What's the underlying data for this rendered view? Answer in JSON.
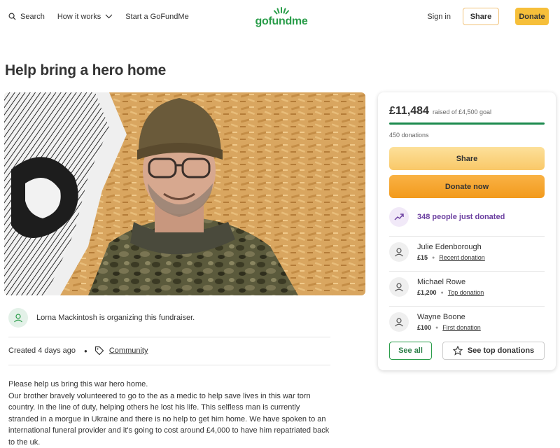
{
  "header": {
    "search_label": "Search",
    "how_it_works_label": "How it works",
    "start_label": "Start a GoFundMe",
    "logo_text": "gofundme",
    "signin_label": "Sign in",
    "share_label": "Share",
    "donate_label": "Donate"
  },
  "campaign": {
    "title": "Help bring a hero home",
    "organizer_text": "Lorna Mackintosh is organizing this fundraiser.",
    "created_text": "Created 4 days ago",
    "category": "Community",
    "story": [
      "Please help us bring this war hero home.",
      "Our brother bravely volunteered to go to the as a medic to help save lives in this war torn country. In the line of duty, helping others he lost his life. This selfless man is currently stranded in a morgue in Ukraine and there is no help to get him home. We have spoken to an international funeral provider and it's going to cost around £4,000 to have him repatriated back to the uk."
    ]
  },
  "card": {
    "raised": "£11,484",
    "goal_text": "raised of £4,500 goal",
    "progress_fraction": 1.0,
    "donations_count": "450 donations",
    "share_label": "Share",
    "donate_now_label": "Donate now",
    "just_donated": "348 people just donated",
    "donors": [
      {
        "name": "Julie Edenborough",
        "amount": "£15",
        "tag": "Recent donation"
      },
      {
        "name": "Michael Rowe",
        "amount": "£1,200",
        "tag": "Top donation"
      },
      {
        "name": "Wayne Boone",
        "amount": "£100",
        "tag": "First donation"
      }
    ],
    "see_all_label": "See all",
    "see_top_label": "See top donations"
  },
  "colors": {
    "brand_green": "#2a9d4a",
    "progress_green": "#1d8a4e",
    "donate_orange": "#f29a1c",
    "accent_purple": "#6b3fa0"
  }
}
